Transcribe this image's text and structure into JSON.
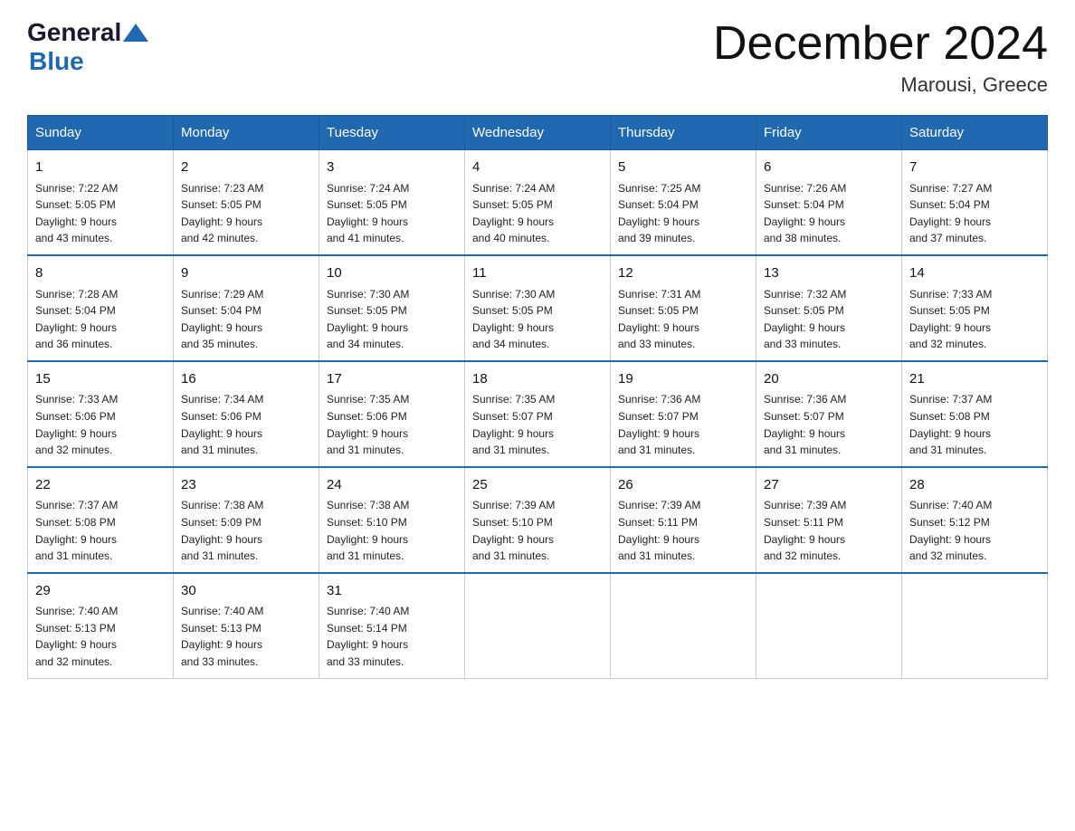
{
  "header": {
    "logo_general": "General",
    "logo_blue": "Blue",
    "title": "December 2024",
    "location": "Marousi, Greece"
  },
  "days_of_week": [
    "Sunday",
    "Monday",
    "Tuesday",
    "Wednesday",
    "Thursday",
    "Friday",
    "Saturday"
  ],
  "weeks": [
    [
      {
        "day": "1",
        "sunrise": "7:22 AM",
        "sunset": "5:05 PM",
        "daylight": "9 hours and 43 minutes."
      },
      {
        "day": "2",
        "sunrise": "7:23 AM",
        "sunset": "5:05 PM",
        "daylight": "9 hours and 42 minutes."
      },
      {
        "day": "3",
        "sunrise": "7:24 AM",
        "sunset": "5:05 PM",
        "daylight": "9 hours and 41 minutes."
      },
      {
        "day": "4",
        "sunrise": "7:24 AM",
        "sunset": "5:05 PM",
        "daylight": "9 hours and 40 minutes."
      },
      {
        "day": "5",
        "sunrise": "7:25 AM",
        "sunset": "5:04 PM",
        "daylight": "9 hours and 39 minutes."
      },
      {
        "day": "6",
        "sunrise": "7:26 AM",
        "sunset": "5:04 PM",
        "daylight": "9 hours and 38 minutes."
      },
      {
        "day": "7",
        "sunrise": "7:27 AM",
        "sunset": "5:04 PM",
        "daylight": "9 hours and 37 minutes."
      }
    ],
    [
      {
        "day": "8",
        "sunrise": "7:28 AM",
        "sunset": "5:04 PM",
        "daylight": "9 hours and 36 minutes."
      },
      {
        "day": "9",
        "sunrise": "7:29 AM",
        "sunset": "5:04 PM",
        "daylight": "9 hours and 35 minutes."
      },
      {
        "day": "10",
        "sunrise": "7:30 AM",
        "sunset": "5:05 PM",
        "daylight": "9 hours and 34 minutes."
      },
      {
        "day": "11",
        "sunrise": "7:30 AM",
        "sunset": "5:05 PM",
        "daylight": "9 hours and 34 minutes."
      },
      {
        "day": "12",
        "sunrise": "7:31 AM",
        "sunset": "5:05 PM",
        "daylight": "9 hours and 33 minutes."
      },
      {
        "day": "13",
        "sunrise": "7:32 AM",
        "sunset": "5:05 PM",
        "daylight": "9 hours and 33 minutes."
      },
      {
        "day": "14",
        "sunrise": "7:33 AM",
        "sunset": "5:05 PM",
        "daylight": "9 hours and 32 minutes."
      }
    ],
    [
      {
        "day": "15",
        "sunrise": "7:33 AM",
        "sunset": "5:06 PM",
        "daylight": "9 hours and 32 minutes."
      },
      {
        "day": "16",
        "sunrise": "7:34 AM",
        "sunset": "5:06 PM",
        "daylight": "9 hours and 31 minutes."
      },
      {
        "day": "17",
        "sunrise": "7:35 AM",
        "sunset": "5:06 PM",
        "daylight": "9 hours and 31 minutes."
      },
      {
        "day": "18",
        "sunrise": "7:35 AM",
        "sunset": "5:07 PM",
        "daylight": "9 hours and 31 minutes."
      },
      {
        "day": "19",
        "sunrise": "7:36 AM",
        "sunset": "5:07 PM",
        "daylight": "9 hours and 31 minutes."
      },
      {
        "day": "20",
        "sunrise": "7:36 AM",
        "sunset": "5:07 PM",
        "daylight": "9 hours and 31 minutes."
      },
      {
        "day": "21",
        "sunrise": "7:37 AM",
        "sunset": "5:08 PM",
        "daylight": "9 hours and 31 minutes."
      }
    ],
    [
      {
        "day": "22",
        "sunrise": "7:37 AM",
        "sunset": "5:08 PM",
        "daylight": "9 hours and 31 minutes."
      },
      {
        "day": "23",
        "sunrise": "7:38 AM",
        "sunset": "5:09 PM",
        "daylight": "9 hours and 31 minutes."
      },
      {
        "day": "24",
        "sunrise": "7:38 AM",
        "sunset": "5:10 PM",
        "daylight": "9 hours and 31 minutes."
      },
      {
        "day": "25",
        "sunrise": "7:39 AM",
        "sunset": "5:10 PM",
        "daylight": "9 hours and 31 minutes."
      },
      {
        "day": "26",
        "sunrise": "7:39 AM",
        "sunset": "5:11 PM",
        "daylight": "9 hours and 31 minutes."
      },
      {
        "day": "27",
        "sunrise": "7:39 AM",
        "sunset": "5:11 PM",
        "daylight": "9 hours and 32 minutes."
      },
      {
        "day": "28",
        "sunrise": "7:40 AM",
        "sunset": "5:12 PM",
        "daylight": "9 hours and 32 minutes."
      }
    ],
    [
      {
        "day": "29",
        "sunrise": "7:40 AM",
        "sunset": "5:13 PM",
        "daylight": "9 hours and 32 minutes."
      },
      {
        "day": "30",
        "sunrise": "7:40 AM",
        "sunset": "5:13 PM",
        "daylight": "9 hours and 33 minutes."
      },
      {
        "day": "31",
        "sunrise": "7:40 AM",
        "sunset": "5:14 PM",
        "daylight": "9 hours and 33 minutes."
      },
      null,
      null,
      null,
      null
    ]
  ],
  "labels": {
    "sunrise": "Sunrise:",
    "sunset": "Sunset:",
    "daylight": "Daylight:"
  }
}
